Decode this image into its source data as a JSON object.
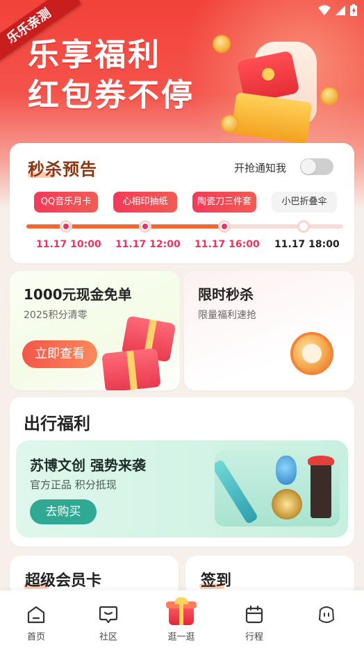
{
  "status_bar": {
    "wifi_icon": "wifi-icon",
    "signal_icon": "signal-icon",
    "battery_icon": "battery-icon"
  },
  "hero": {
    "ribbon": "乐乐亲测",
    "title_line1": "乐享福利",
    "title_line2": "红包券不停"
  },
  "flash_sale": {
    "title": "秒杀预告",
    "notify_label": "开抢通知我",
    "notify_enabled": false,
    "items": [
      {
        "label": "QQ音乐月卡",
        "time": "11.17 10:00",
        "status": "done"
      },
      {
        "label": "心相印抽纸",
        "time": "11.17 12:00",
        "status": "done"
      },
      {
        "label": "陶瓷刀三件套",
        "time": "11.17 16:00",
        "status": "done"
      },
      {
        "label": "小巴折叠伞",
        "time": "11.17 18:00",
        "status": "upcoming"
      }
    ]
  },
  "promos": {
    "cash": {
      "title": "1000元现金免单",
      "subtitle": "2025积分清零",
      "button": "立即查看"
    },
    "limited": {
      "title": "限时秒杀",
      "subtitle": "限量福利速抢"
    }
  },
  "travel": {
    "title": "出行福利",
    "heading": "苏博文创 强势来袭",
    "subtitle": "官方正品 积分抵现",
    "button": "去购买"
  },
  "bottom_cards": {
    "vip": "超级会员卡",
    "checkin": "签到"
  },
  "tabbar": [
    {
      "label": "首页",
      "icon": "home-icon"
    },
    {
      "label": "社区",
      "icon": "community-icon"
    },
    {
      "label": "逛一逛",
      "icon": "gift-icon"
    },
    {
      "label": "行程",
      "icon": "calendar-icon"
    },
    {
      "label": "",
      "icon": "profile-icon"
    }
  ],
  "colors": {
    "brand_red": "#f2423a",
    "accent_pink": "#e8345f",
    "accent_orange": "#f4672e",
    "teal_button": "#2fa894"
  }
}
